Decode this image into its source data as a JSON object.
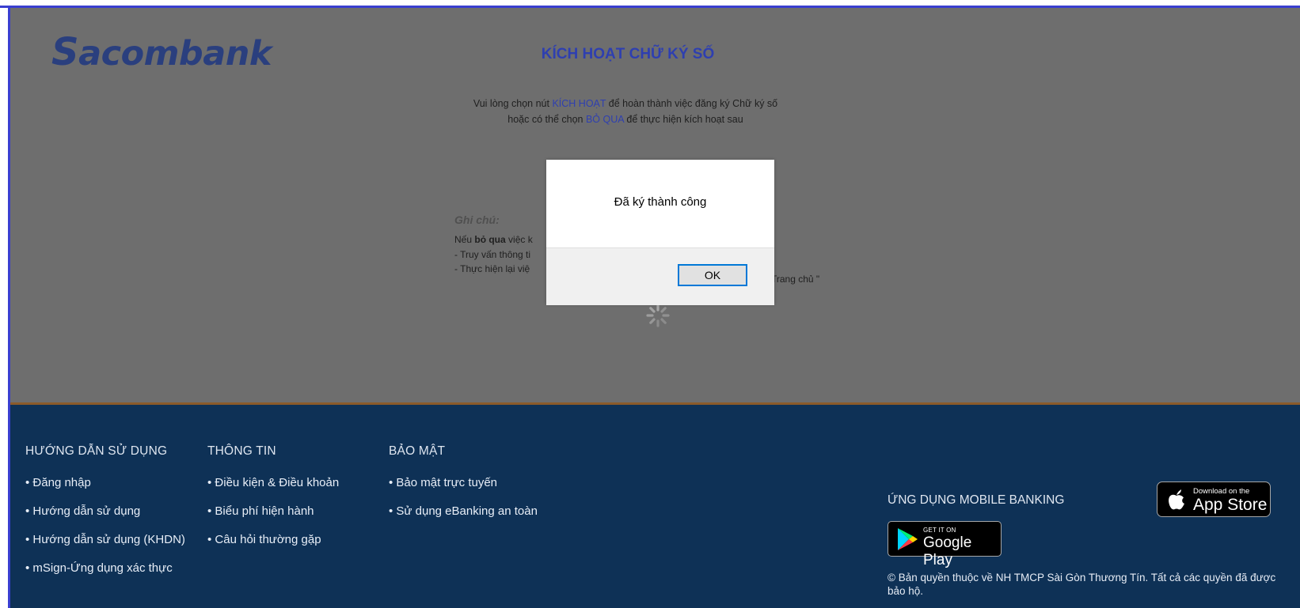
{
  "logo": {
    "prefix": "S",
    "rest": "acombank"
  },
  "page": {
    "title": "KÍCH HOẠT CHỮ KÝ SỐ",
    "instructions": {
      "line1_before": "Vui lòng chọn nút ",
      "line1_highlight": "KÍCH HOẠT",
      "line1_after": " để hoàn thành việc đăng ký Chữ ký số",
      "line2_before": "hoặc có thể chọn ",
      "line2_highlight": "BỎ QUA",
      "line2_after": " để thực hiện kích hoạt sau"
    },
    "notes": {
      "heading": "Ghi chú:",
      "line1_before": "Nếu ",
      "line1_bold": "bỏ qua",
      "line1_after": " việc k",
      "line2": "- Truy vấn thông ti",
      "line3": "- Thực hiện lại việ",
      "line3_tail": "Trang chủ \""
    }
  },
  "dialog": {
    "message": "Đã ký thành công",
    "ok_label": "OK"
  },
  "footer": {
    "columns": [
      {
        "heading": "HƯỚNG DẪN SỬ DỤNG",
        "items": [
          "Đăng nhập",
          "Hướng dẫn sử dụng",
          "Hướng dẫn sử dụng (KHDN)",
          "mSign-Ứng dụng xác thực"
        ]
      },
      {
        "heading": "THÔNG TIN",
        "items": [
          "Điều kiện & Điều khoản",
          "Biểu phí hiện hành",
          "Câu hỏi thường gặp"
        ]
      },
      {
        "heading": "BẢO MẬT",
        "items": [
          "Bảo mật trực tuyến",
          "Sử dụng eBanking an toàn"
        ]
      }
    ],
    "mobile_heading": "ỨNG DỤNG MOBILE BANKING",
    "google_play": {
      "small": "GET IT ON",
      "big": "Google Play"
    },
    "app_store": {
      "small": "Download on the",
      "big": "App Store"
    },
    "copyright": "© Bản quyền thuộc về NH TMCP Sài Gòn Thương Tín. Tất cả các quyền đã được bảo hộ."
  },
  "colors": {
    "brand": "#2a3f7e",
    "accent_link": "#2e3fb0",
    "footer_bg": "#0e3156",
    "overlay": "#6e6e6e",
    "focus": "#0078d7"
  }
}
